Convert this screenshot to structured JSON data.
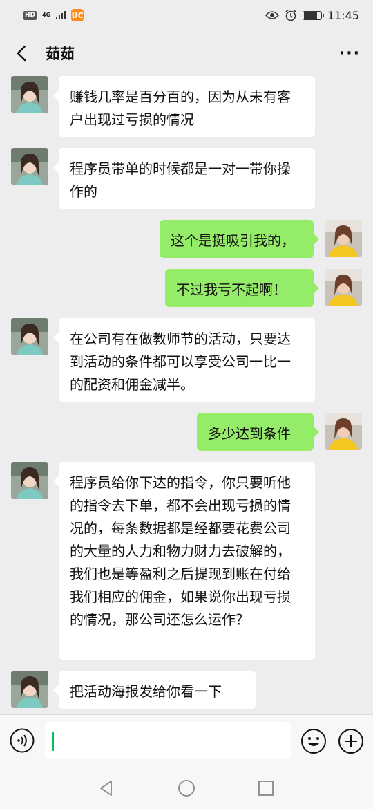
{
  "status_bar": {
    "hd": "HD",
    "network": "4G",
    "uc": "UC",
    "time": "11:45",
    "battery_level": 0.85
  },
  "header": {
    "title": "茹茹"
  },
  "messages": [
    {
      "side": "in",
      "text": "赚钱几率是百分百的，因为从未有客户出现过亏损的情况"
    },
    {
      "side": "in",
      "text": "程序员带单的时候都是一对一带你操作的"
    },
    {
      "side": "out",
      "text": "这个是挺吸引我的，"
    },
    {
      "side": "out",
      "text": "不过我亏不起啊！"
    },
    {
      "side": "in",
      "text": "在公司有在做教师节的活动，只要达到活动的条件都可以享受公司一比一的配资和佣金减半。"
    },
    {
      "side": "out",
      "text": "多少达到条件"
    },
    {
      "side": "in",
      "text": "程序员给你下达的指令，你只要听他的指令去下单，都不会出现亏损的情况的，每条数据都是经都要花费公司的大量的人力和物力财力去破解的，我们也是等盈利之后提现到账在付给我们相应的佣金，如果说你出现亏损的情况，那公司还怎么运作？"
    },
    {
      "side": "in",
      "text": "把活动海报发给你看一下"
    }
  ],
  "input": {
    "value": ""
  },
  "icons": {
    "back": "back-arrow-icon",
    "more": "more-dots-icon",
    "voice": "voice-icon",
    "emoji": "emoji-icon",
    "plus": "plus-icon",
    "eye": "eye-comfort-icon",
    "alarm": "alarm-icon"
  },
  "colors": {
    "outgoing_bubble": "#95ec69",
    "incoming_bubble": "#ffffff",
    "background": "#ededed",
    "caret": "#07c160"
  }
}
